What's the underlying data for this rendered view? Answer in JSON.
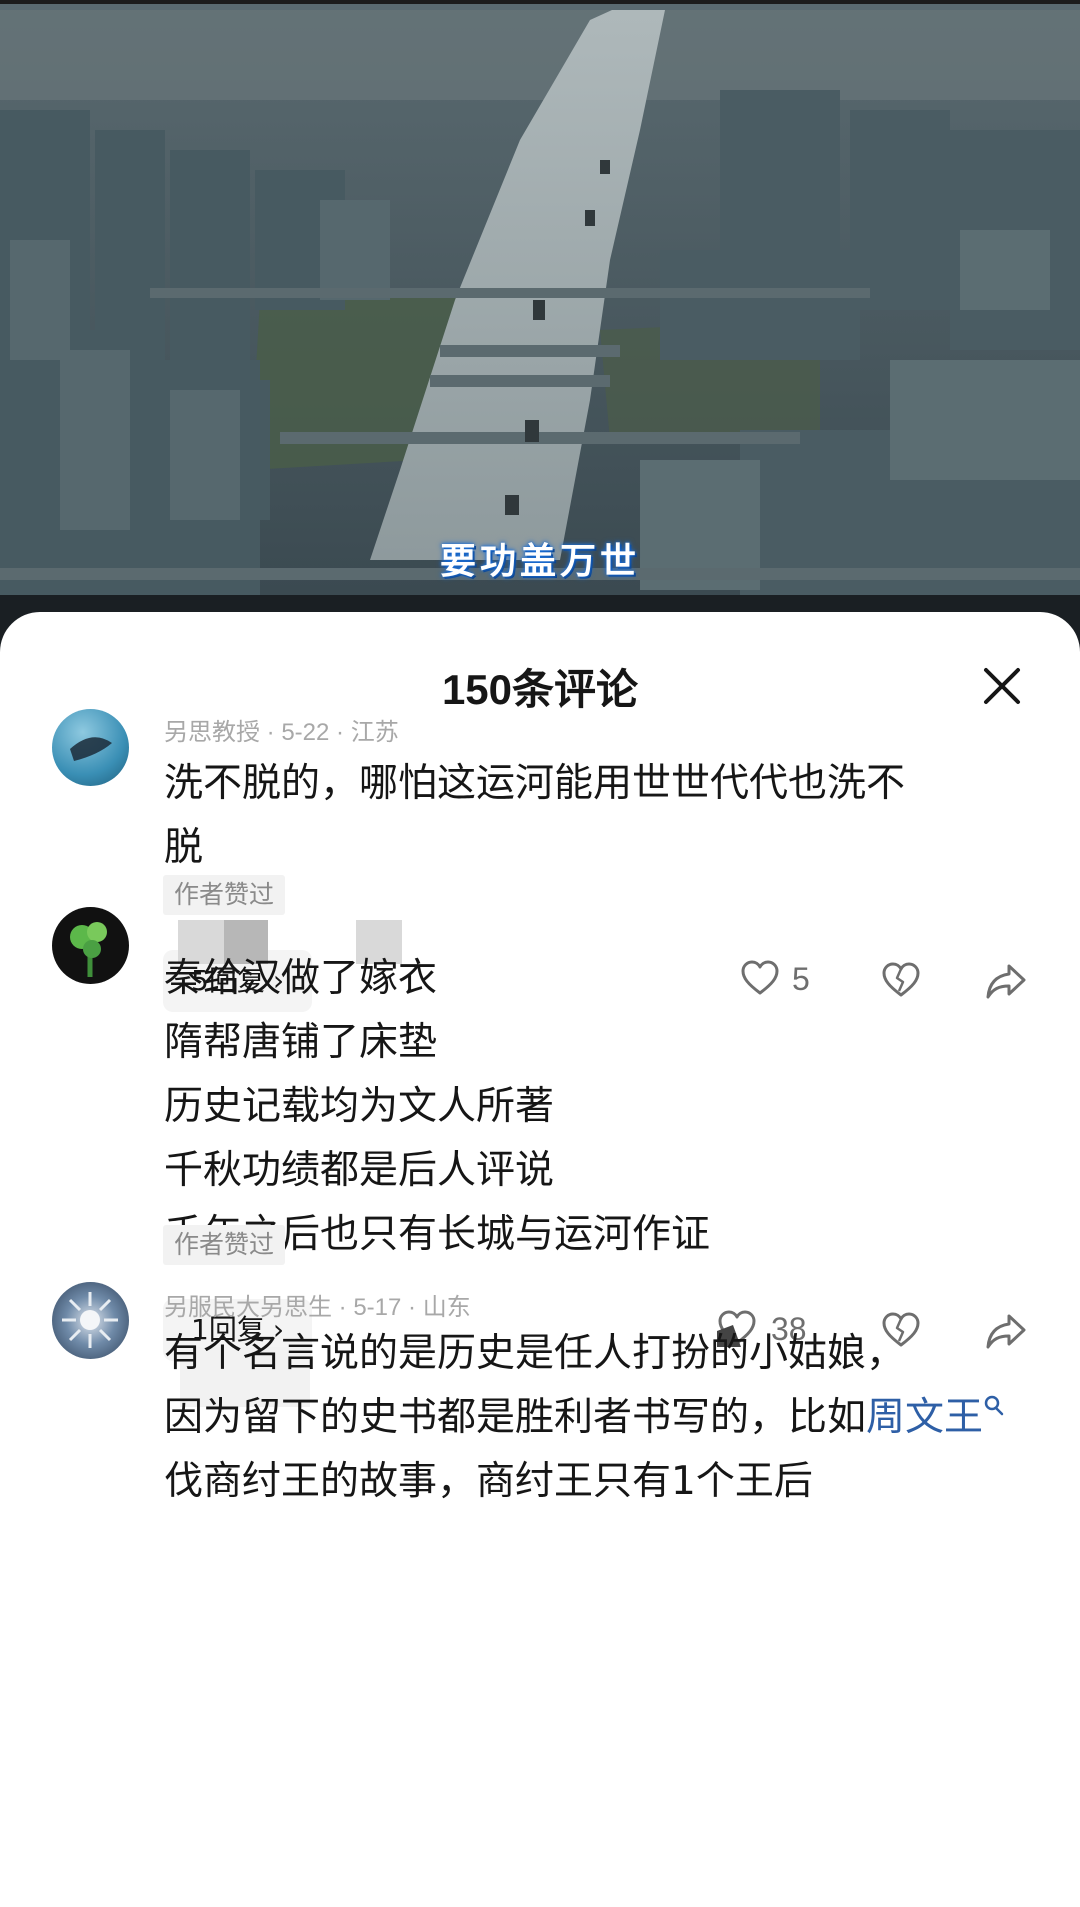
{
  "video": {
    "subtitle": "要功盖万世"
  },
  "sheet": {
    "title": "150条评论",
    "close_icon": "close-icon"
  },
  "comments": [
    {
      "username": "另思教授 · 5-22 · 江苏",
      "text": "洗不脱的，哪怕这运河能用世世代代也洗不\n脱",
      "badge": "作者赞过",
      "replies": "5回复",
      "likes": "5"
    },
    {
      "username": "",
      "text": "秦给汉做了嫁衣\n隋帮唐铺了床垫\n历史记载均为文人所著\n千秋功绩都是后人评说\n千年之后也只有长城与运河作证",
      "badge": "作者赞过",
      "replies": "1回复",
      "likes": "38"
    },
    {
      "username": "另服民大另思生 · 5-17 · 山东",
      "text_before_link": "有个名言说的是历史是任人打扮的小姑娘，\n因为留下的史书都是胜利者书写的，比如",
      "link": "周文王",
      "text_after_link": "伐商纣王的故事，商纣王只有1个王后"
    }
  ],
  "icons": {
    "like": "heart-icon",
    "dislike": "broken-heart-icon",
    "share": "share-arrow-icon",
    "search": "search-icon",
    "chevron": "chevron-right-icon"
  }
}
